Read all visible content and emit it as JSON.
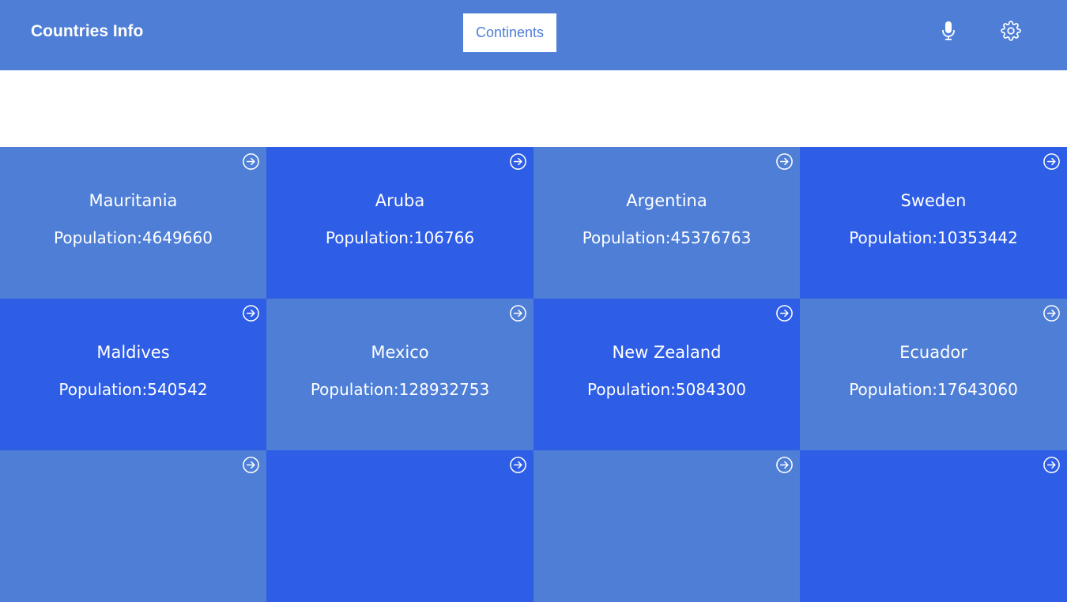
{
  "header": {
    "title": "Countries Info",
    "continents_label": "Continents",
    "mic_icon": "microphone-icon",
    "settings_icon": "gear-icon"
  },
  "colors": {
    "header_bg": "#4e7ed6",
    "card_light": "#4e7ed6",
    "card_dark": "#2e5de6",
    "text": "#ffffff"
  },
  "cards": [
    {
      "name": "Mauritania",
      "population": "Population:4649660",
      "shade": "light"
    },
    {
      "name": "Aruba",
      "population": "Population:106766",
      "shade": "dark"
    },
    {
      "name": "Argentina",
      "population": "Population:45376763",
      "shade": "light"
    },
    {
      "name": "Sweden",
      "population": "Population:10353442",
      "shade": "dark"
    },
    {
      "name": "Maldives",
      "population": "Population:540542",
      "shade": "dark"
    },
    {
      "name": "Mexico",
      "population": "Population:128932753",
      "shade": "light"
    },
    {
      "name": "New Zealand",
      "population": "Population:5084300",
      "shade": "dark"
    },
    {
      "name": "Ecuador",
      "population": "Population:17643060",
      "shade": "light"
    },
    {
      "name": "",
      "population": "",
      "shade": "light"
    },
    {
      "name": "",
      "population": "",
      "shade": "dark"
    },
    {
      "name": "",
      "population": "",
      "shade": "light"
    },
    {
      "name": "",
      "population": "",
      "shade": "dark"
    }
  ]
}
